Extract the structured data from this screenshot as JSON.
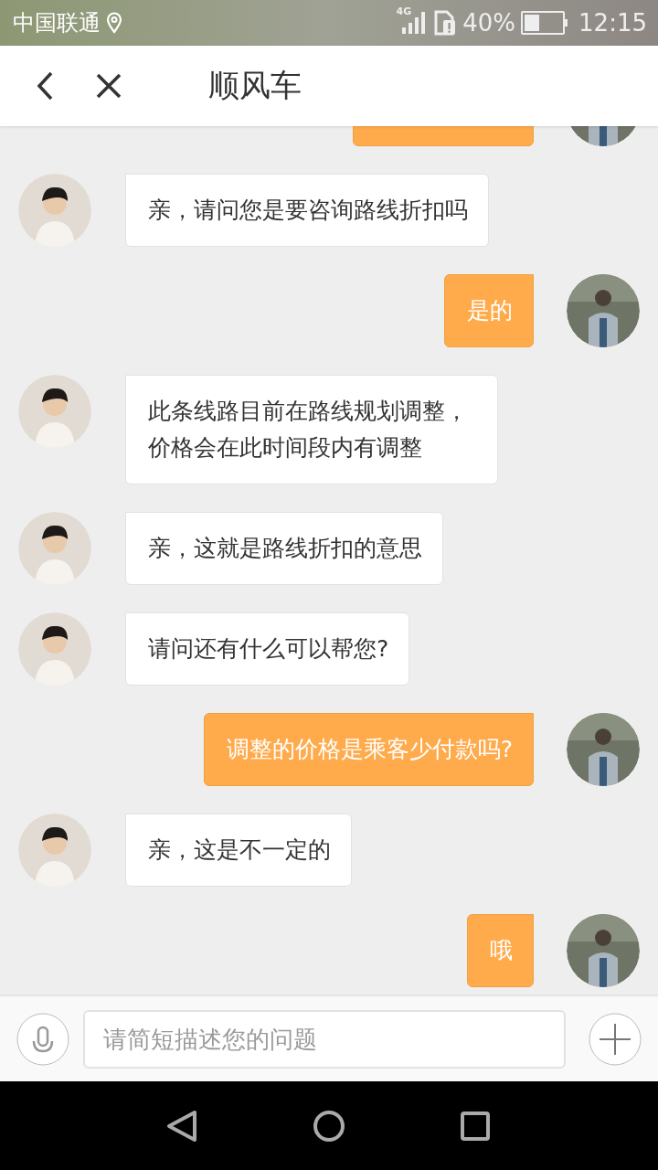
{
  "status_bar": {
    "carrier": "中国联通",
    "network": "4G",
    "battery": "40%",
    "time": "12:15"
  },
  "header": {
    "title": "顺风车"
  },
  "messages": [
    {
      "kind": "sent",
      "partial": true
    },
    {
      "kind": "received",
      "text": "亲，请问您是要咨询路线折扣吗"
    },
    {
      "kind": "sent",
      "text": "是的"
    },
    {
      "kind": "received",
      "text": "此条线路目前在路线规划调整，价格会在此时间段内有调整"
    },
    {
      "kind": "received",
      "text": "亲，这就是路线折扣的意思"
    },
    {
      "kind": "received",
      "text": "请问还有什么可以帮您?"
    },
    {
      "kind": "sent",
      "text": "调整的价格是乘客少付款吗?"
    },
    {
      "kind": "received",
      "text": "亲，这是不一定的"
    },
    {
      "kind": "sent",
      "text": "哦"
    }
  ],
  "input": {
    "placeholder": "请简短描述您的问题"
  }
}
